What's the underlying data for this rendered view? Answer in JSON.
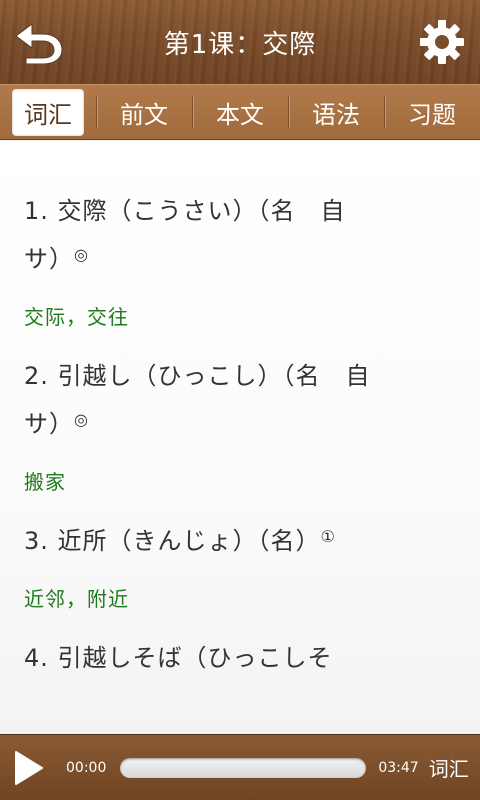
{
  "header": {
    "title": "第1课：交際"
  },
  "tabs": [
    {
      "label": "词汇",
      "active": true
    },
    {
      "label": "前文",
      "active": false
    },
    {
      "label": "本文",
      "active": false
    },
    {
      "label": "语法",
      "active": false
    },
    {
      "label": "习题",
      "active": false
    }
  ],
  "entries": [
    {
      "jp_line1": "1. 交際（こうさい）（名　自",
      "jp_line2": "サ）",
      "accent": "◎",
      "meaning": "交际，交往"
    },
    {
      "jp_line1": "2. 引越し（ひっこし）（名　自",
      "jp_line2": "サ）",
      "accent": "◎",
      "meaning": "搬家"
    },
    {
      "jp_line1": "3. 近所（きんじょ）（名）",
      "accent": "①",
      "meaning": "近邻，附近"
    },
    {
      "jp_line1": "4. 引越しそば（ひっこしそ"
    }
  ],
  "player": {
    "current_time": "00:00",
    "total_time": "03:47",
    "label": "词汇",
    "progress": 0
  },
  "colors": {
    "wood": "#7a4c2a",
    "meaning_green": "#1f7a1f"
  }
}
